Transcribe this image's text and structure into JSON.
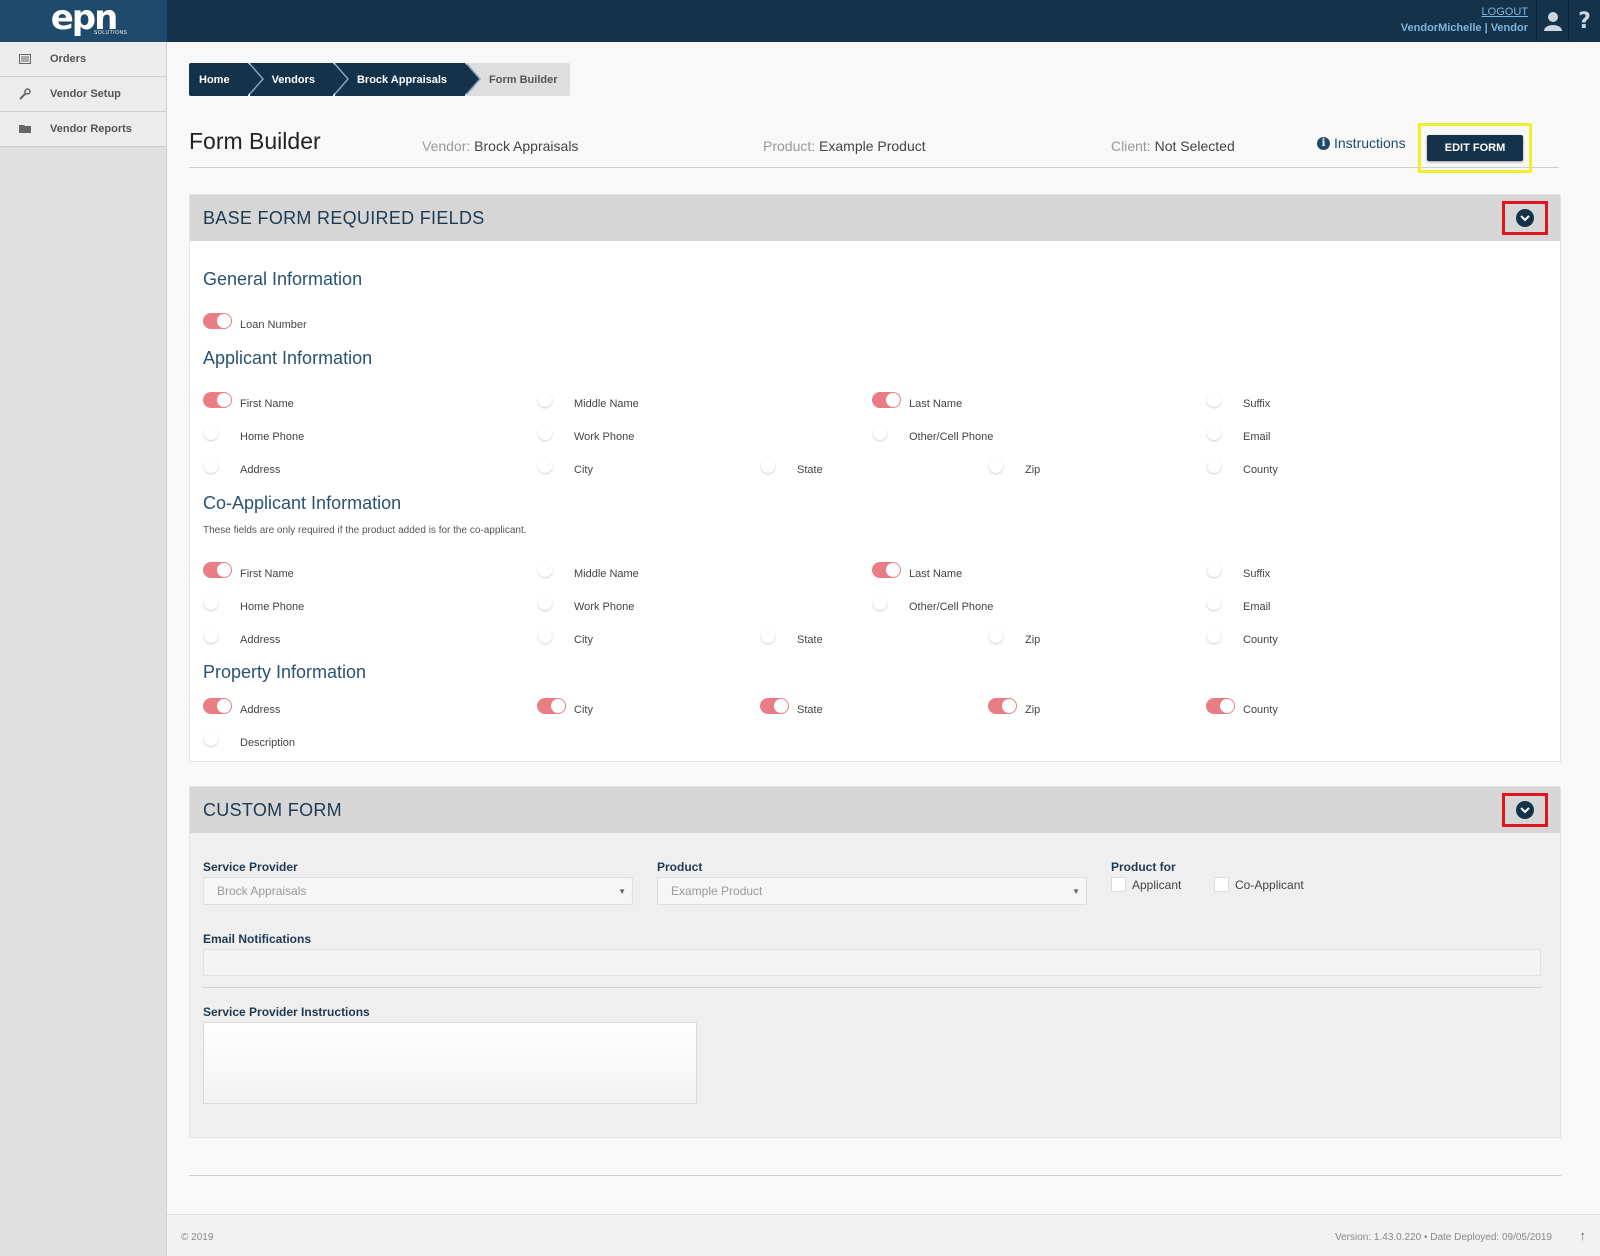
{
  "brand": {
    "logo": "epn",
    "logo_sub": "SOLUTIONS"
  },
  "header": {
    "logout": "LOGOUT",
    "user": "VendorMichelle",
    "role": "Vendor",
    "sep": "|"
  },
  "sidebar": {
    "items": [
      {
        "label": "Orders",
        "icon": "orders-icon"
      },
      {
        "label": "Vendor Setup",
        "icon": "wrench-icon"
      },
      {
        "label": "Vendor Reports",
        "icon": "folder-icon"
      }
    ]
  },
  "breadcrumb": [
    "Home",
    "Vendors",
    "Brock Appraisals",
    "Form Builder"
  ],
  "page": {
    "title": "Form Builder",
    "vendor_key": "Vendor:",
    "vendor_val": "Brock Appraisals",
    "product_key": "Product:",
    "product_val": "Example Product",
    "client_key": "Client:",
    "client_val": "Not Selected",
    "instructions": "Instructions",
    "edit_form": "EDIT FORM"
  },
  "base_form": {
    "title": "BASE FORM REQUIRED FIELDS",
    "general": {
      "title": "General Information",
      "fields": [
        {
          "label": "Loan Number",
          "on": true
        }
      ]
    },
    "applicant": {
      "title": "Applicant Information",
      "fields": [
        {
          "label": "First Name",
          "on": true
        },
        {
          "label": "Middle Name",
          "on": false
        },
        {
          "label": "Last Name",
          "on": true
        },
        {
          "label": "Suffix",
          "on": false
        },
        {
          "label": "Home Phone",
          "on": false
        },
        {
          "label": "Work Phone",
          "on": false
        },
        {
          "label": "Other/Cell Phone",
          "on": false
        },
        {
          "label": "Email",
          "on": false
        },
        {
          "label": "Address",
          "on": false
        },
        {
          "label": "City",
          "on": false
        },
        {
          "label": "State",
          "on": false
        },
        {
          "label": "Zip",
          "on": false
        },
        {
          "label": "County",
          "on": false
        }
      ]
    },
    "co_applicant": {
      "title": "Co-Applicant Information",
      "note": "These fields are only required if the product added is for the co-applicant.",
      "fields": [
        {
          "label": "First Name",
          "on": true
        },
        {
          "label": "Middle Name",
          "on": false
        },
        {
          "label": "Last Name",
          "on": true
        },
        {
          "label": "Suffix",
          "on": false
        },
        {
          "label": "Home Phone",
          "on": false
        },
        {
          "label": "Work Phone",
          "on": false
        },
        {
          "label": "Other/Cell Phone",
          "on": false
        },
        {
          "label": "Email",
          "on": false
        },
        {
          "label": "Address",
          "on": false
        },
        {
          "label": "City",
          "on": false
        },
        {
          "label": "State",
          "on": false
        },
        {
          "label": "Zip",
          "on": false
        },
        {
          "label": "County",
          "on": false
        }
      ]
    },
    "property": {
      "title": "Property Information",
      "fields": [
        {
          "label": "Address",
          "on": true
        },
        {
          "label": "City",
          "on": true
        },
        {
          "label": "State",
          "on": true
        },
        {
          "label": "Zip",
          "on": true
        },
        {
          "label": "County",
          "on": true
        },
        {
          "label": "Description",
          "on": false
        }
      ]
    }
  },
  "custom_form": {
    "title": "CUSTOM FORM",
    "service_provider_label": "Service Provider",
    "service_provider_value": "Brock Appraisals",
    "product_label": "Product",
    "product_value": "Example Product",
    "product_for_label": "Product for",
    "applicant_label": "Applicant",
    "co_applicant_label": "Co-Applicant",
    "email_label": "Email Notifications",
    "email_value": "",
    "instructions_label": "Service Provider Instructions",
    "instructions_value": ""
  },
  "footer": {
    "copyright": "© 2019",
    "version": "Version: 1.43.0.220  •  Date Deployed: 09/05/2019",
    "up": "↑"
  },
  "colors": {
    "navy": "#14334b",
    "toggle_on": "#e87d86",
    "highlight_yellow": "#f0ee2a",
    "highlight_red": "#e0141e"
  }
}
